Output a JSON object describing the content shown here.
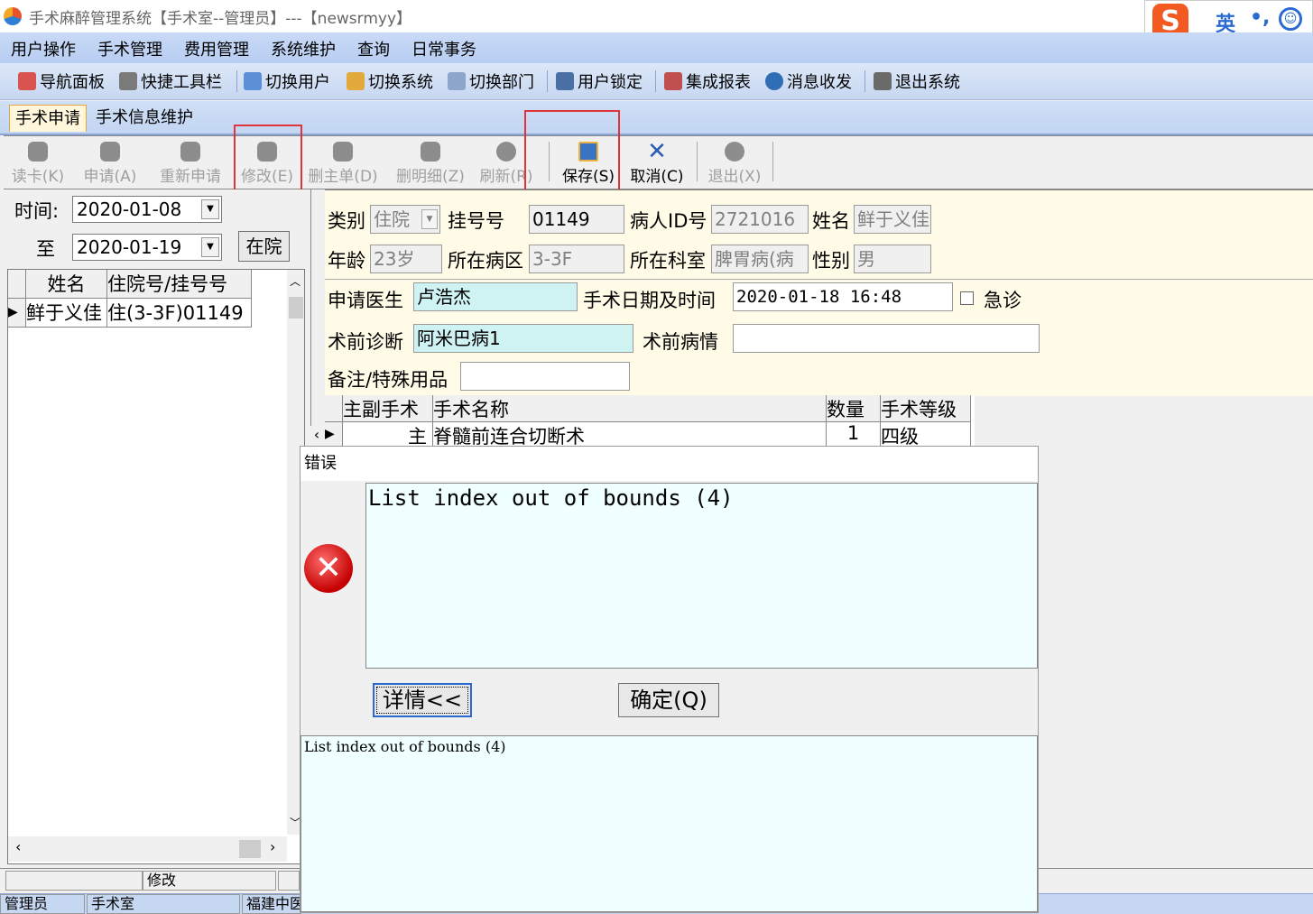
{
  "window": {
    "title": "手术麻醉管理系统【手术室--管理员】---【newsrmyy】"
  },
  "ime": {
    "logo": "S",
    "lang": "英",
    "punct": "•,",
    "emoji": "☺"
  },
  "menu": [
    "用户操作",
    "手术管理",
    "费用管理",
    "系统维护",
    "查询",
    "日常事务"
  ],
  "toolbar": [
    "导航面板",
    "快捷工具栏",
    "切换用户",
    "切换系统",
    "切换部门",
    "用户锁定",
    "集成报表",
    "消息收发",
    "退出系统"
  ],
  "tabs": [
    "手术申请",
    "手术信息维护"
  ],
  "actions": [
    {
      "label": "读卡(K)"
    },
    {
      "label": "申请(A)"
    },
    {
      "label": "重新申请"
    },
    {
      "label": "修改(E)"
    },
    {
      "label": "删主单(D)"
    },
    {
      "label": "删明细(Z)"
    },
    {
      "label": "刷新(R)"
    },
    {
      "label": "保存(S)"
    },
    {
      "label": "取消(C)"
    },
    {
      "label": "退出(X)"
    }
  ],
  "filter": {
    "time_label": "时间:",
    "date_from": "2020-01-08",
    "to_label": "至",
    "date_to": "2020-01-19",
    "status_button": "在院"
  },
  "patient_list": {
    "columns": [
      "姓名",
      "住院号/挂号号"
    ],
    "rows": [
      {
        "name": "鲜于义佳",
        "id": "住(3-3F)01149"
      }
    ]
  },
  "form": {
    "category_label": "类别",
    "category_value": "住院",
    "reg_no_label": "挂号号",
    "reg_no_value": "01149",
    "patient_id_label": "病人ID号",
    "patient_id_value": "2721016",
    "name_label": "姓名",
    "name_value": "鲜于义佳",
    "age_label": "年龄",
    "age_value": "23岁",
    "ward_label": "所在病区",
    "ward_value": "3-3F",
    "dept_label": "所在科室",
    "dept_value": "脾胃病(病",
    "gender_label": "性别",
    "gender_value": "男",
    "doctor_label": "申请医生",
    "doctor_value": "卢浩杰",
    "op_datetime_label": "手术日期及时间",
    "op_datetime_value": "2020-01-18 16:48",
    "emergency_label": "急诊",
    "diagnosis_label": "术前诊断",
    "diagnosis_value": "阿米巴病1",
    "condition_label": "术前病情",
    "condition_value": "",
    "remark_label": "备注/特殊用品",
    "remark_value": ""
  },
  "operations": {
    "columns": [
      "主副手术",
      "手术名称",
      "数量",
      "手术等级"
    ],
    "rows": [
      {
        "type": "主",
        "name": "脊髓前连合切断术",
        "qty": "1",
        "level": "四级"
      }
    ]
  },
  "dialog": {
    "title": "错误",
    "message": "List index out of bounds (4)",
    "details_button": "详情<<",
    "ok_button": "确定(Q)",
    "detail_text": "List index out of bounds (4)"
  },
  "status": {
    "edit_mode": "修改",
    "user": "管理员",
    "dept": "手术室",
    "hospital": "福建中医"
  }
}
